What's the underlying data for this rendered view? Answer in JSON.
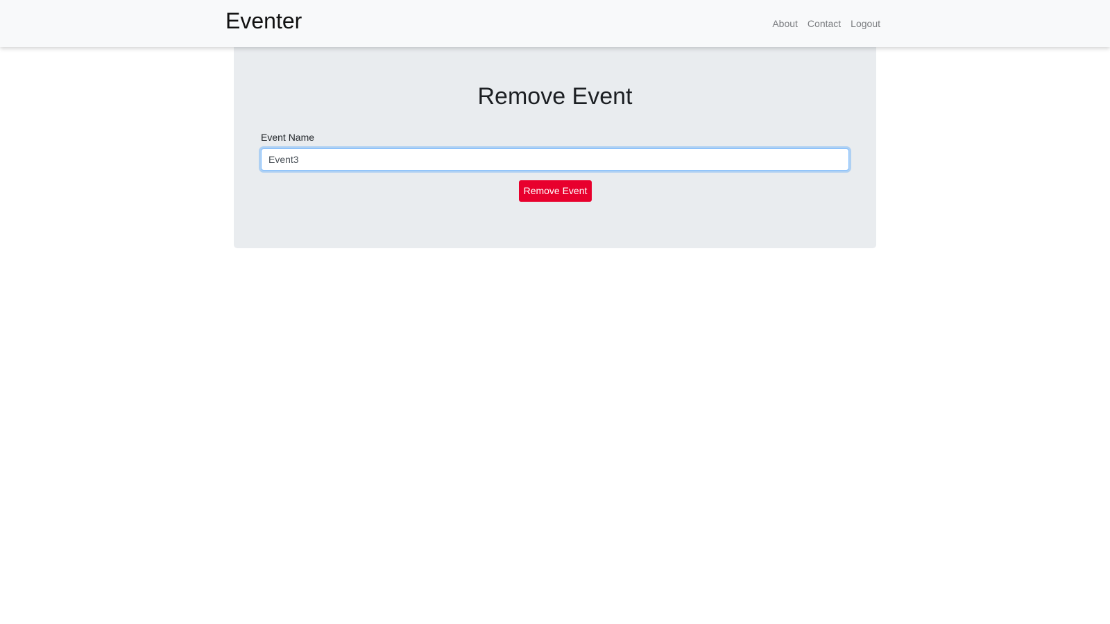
{
  "navbar": {
    "brand": "Eventer",
    "links": [
      {
        "label": "About"
      },
      {
        "label": "Contact"
      },
      {
        "label": "Logout"
      }
    ]
  },
  "main": {
    "title": "Remove Event",
    "form": {
      "event_name_label": "Event Name",
      "event_name_value": "Event3",
      "submit_label": "Remove Event"
    }
  },
  "colors": {
    "navbar_bg": "#f8f9fa",
    "panel_bg": "#e9ecef",
    "danger_button": "#e8002d",
    "input_focus_border": "#80bdff"
  }
}
